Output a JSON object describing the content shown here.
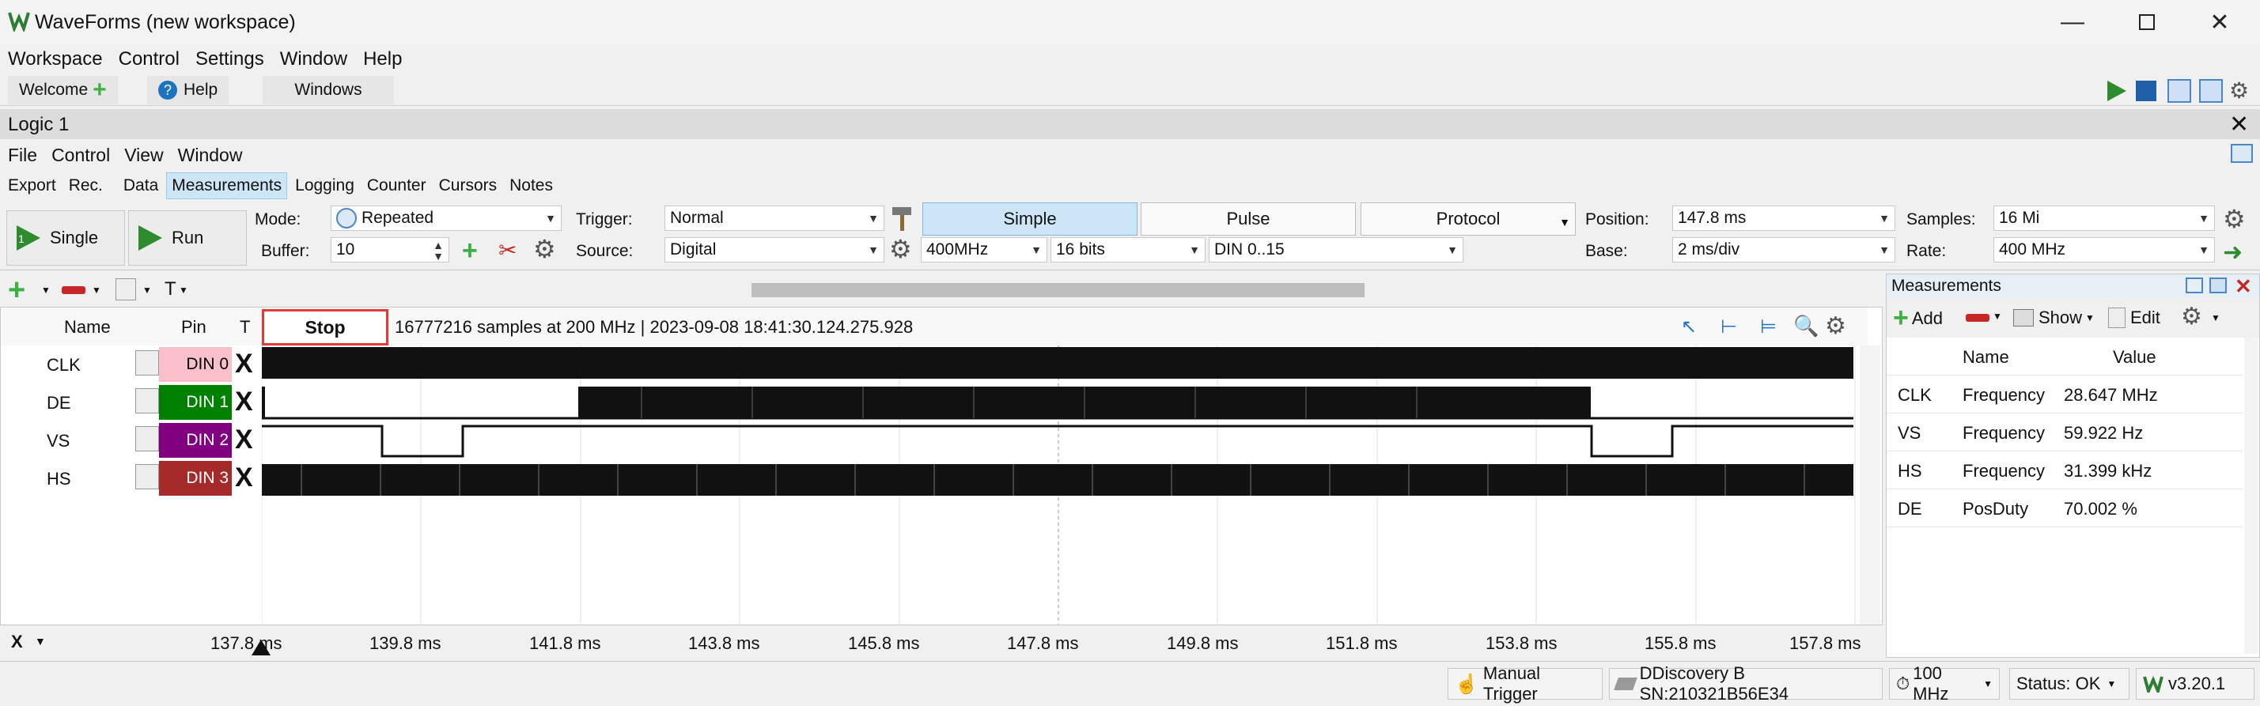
{
  "window": {
    "title": "WaveForms (new workspace)"
  },
  "menubar": {
    "items": [
      "Workspace",
      "Control",
      "Settings",
      "Window",
      "Help"
    ]
  },
  "tabs": {
    "welcome": "Welcome",
    "help": "Help",
    "windows": "Windows"
  },
  "instrument": {
    "title": "Logic 1"
  },
  "submenu": {
    "items": [
      "File",
      "Control",
      "View",
      "Window"
    ]
  },
  "subtabs": {
    "items": [
      "Export",
      "Rec.",
      "Data",
      "Measurements",
      "Logging",
      "Counter",
      "Cursors",
      "Notes"
    ],
    "selected": "Measurements"
  },
  "toolbar": {
    "single_label": "Single",
    "run_label": "Run",
    "mode_label": "Mode:",
    "mode_value": "Repeated",
    "buffer_label": "Buffer:",
    "buffer_value": "10",
    "trigger_label": "Trigger:",
    "trigger_value": "Normal",
    "source_label": "Source:",
    "source_value": "Digital",
    "trig_freq": "400MHz",
    "trig_bits": "16 bits",
    "trig_din": "DIN 0..15",
    "seg_simple": "Simple",
    "seg_pulse": "Pulse",
    "seg_protocol": "Protocol",
    "position_label": "Position:",
    "position_value": "147.8 ms",
    "base_label": "Base:",
    "base_value": "2 ms/div",
    "samples_label": "Samples:",
    "samples_value": "16 Mi",
    "rate_label": "Rate:",
    "rate_value": "400 MHz"
  },
  "plot": {
    "col_name": "Name",
    "col_pin": "Pin",
    "col_t": "T",
    "stop_label": "Stop",
    "info": "16777216 samples at 200 MHz | 2023-09-08 18:41:30.124.275.928",
    "channels": [
      {
        "name": "CLK",
        "pin": "DIN 0",
        "color": "#f9c0cb",
        "trig": "X"
      },
      {
        "name": "DE",
        "pin": "DIN 1",
        "color": "#008000",
        "trig": "X"
      },
      {
        "name": "VS",
        "pin": "DIN 2",
        "color": "#800080",
        "trig": "X"
      },
      {
        "name": "HS",
        "pin": "DIN 3",
        "color": "#a52a2a",
        "trig": "X"
      }
    ],
    "time_ticks": [
      "137.8 ms",
      "139.8 ms",
      "141.8 ms",
      "143.8 ms",
      "145.8 ms",
      "147.8 ms",
      "149.8 ms",
      "151.8 ms",
      "153.8 ms",
      "155.8 ms",
      "157.8 ms"
    ],
    "axis_x_label": "X"
  },
  "measurements": {
    "title": "Measurements",
    "add_label": "Add",
    "show_label": "Show",
    "edit_label": "Edit",
    "col_name": "Name",
    "col_value": "Value",
    "rows": [
      {
        "ch": "CLK",
        "name": "Frequency",
        "value": "28.647 MHz"
      },
      {
        "ch": "VS",
        "name": "Frequency",
        "value": "59.922 Hz"
      },
      {
        "ch": "HS",
        "name": "Frequency",
        "value": "31.399 kHz"
      },
      {
        "ch": "DE",
        "name": "PosDuty",
        "value": "70.002 %"
      }
    ]
  },
  "statusbar": {
    "trigger": "Manual Trigger",
    "device": "DDiscovery B SN:210321B56E34",
    "clock": "100 MHz",
    "status": "Status: OK",
    "version": "v3.20.1"
  }
}
